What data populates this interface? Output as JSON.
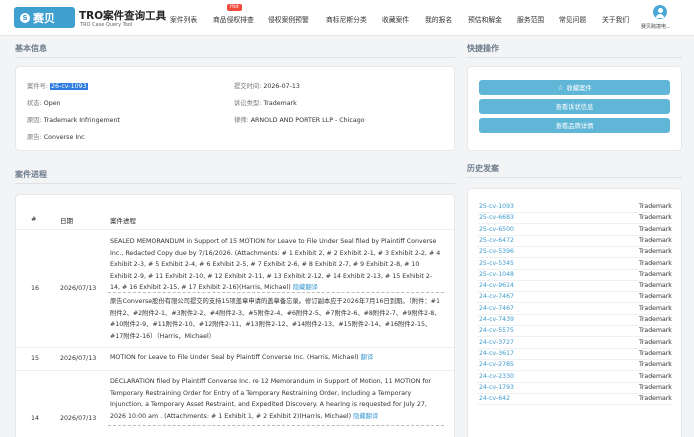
{
  "header": {
    "logo_text": "赛贝",
    "title": "TRO案件查询工具",
    "subtitle": "TRO Case Query Tool",
    "hot_badge": "Hot",
    "nav": [
      "案件列表",
      "商品侵权排查",
      "侵权案例预警",
      "商标尼斯分类",
      "收藏案件",
      "我的报名",
      "预估和解金",
      "服务范围",
      "常见问题",
      "关于我们"
    ],
    "user_name": "赛贝跨境电..."
  },
  "basic_info": {
    "title": "基本信息",
    "case_no_label": "案件号:",
    "case_no": "26-cv-1093",
    "filed_label": "提交时间:",
    "filed": "2026-07-13",
    "status_label": "状态:",
    "status": "Open",
    "ip_label": "诉讼类型:",
    "ip": "Trademark",
    "cause_label": "原因:",
    "cause": "Trademark Infringement",
    "law_label": "律师:",
    "law": "ARNOLD AND PORTER LLP - Chicago",
    "plaintiff_label": "原告:",
    "plaintiff": "Converse Inc"
  },
  "quick_actions": {
    "title": "快捷操作",
    "favorite": "收藏案件",
    "complaint": "查看诉状信息",
    "brand": "查看品牌详情"
  },
  "progress": {
    "title": "案件进程",
    "headers": [
      "#",
      "日期",
      "案件进程"
    ],
    "rows": [
      {
        "num": "16",
        "date": "2026/07/13",
        "en": "SEALED MEMORANDUM in Support of 15 MOTION for Leave to File Under Seal filed by Plaintiff Converse Inc., Redacted Copy due by 7/16/2026. (Attachments: # 1 Exhibit 2, # 2 Exhibit 2-1, # 3 Exhibit 2-2, # 4 Exhibit 2-3, # 5 Exhibit 2-4, # 6 Exhibit 2-5, # 7 Exhibit 2-6, # 8 Exhibit 2-7, # 9 Exhibit 2-8, # 10 Exhibit 2-9, # 11 Exhibit 2-10, # 12 Exhibit 2-11, # 13 Exhibit 2-12, # 14 Exhibit 2-13, # 15 Exhibit 2-14, # 16 Exhibit 2-15, # 17 Exhibit 2-16)(Harris, Michael)",
        "link": "隐藏翻译",
        "zh": "原告Converse股份有限公司提交的支持15项盖章申请的盖章备忘录。修订副本应于2026年7月16日到期。（附件：#1附件2、#2附件2-1、#3附件2-2、#4附件2-3、#5附件2-4、#6附件2-5、#7附件2-6、#8附件2-7、#9附件2-8、#10附件2-9、#11附件2-10、#12附件2-11、#13附件2-12、#14附件2-13、#15附件2-14、#16附件2-15、#17附件2-16）（Harris，Michael）"
      },
      {
        "num": "15",
        "date": "2026/07/13",
        "en": "MOTION for Leave to File Under Seal by Plaintiff Converse Inc. (Harris, Michael)",
        "link": "翻译"
      },
      {
        "num": "14",
        "date": "2026/07/13",
        "en": "DECLARATION filed by Plaintiff Converse Inc. re 12 Memorandum in Support of Motion, 11 MOTION for Temporary Restraining Order for Entry of a Temporary Restraining Order, Including a Temporary Injunction, a Temporary Asset Restraint, and Expedited Discovery. A hearing is requested for July 27, 2026 10:00 am . (Attachments: # 1 Exhibit 1, # 2 Exhibit 2)(Harris, Michael)",
        "link": "隐藏翻译"
      }
    ]
  },
  "history": {
    "title": "历史发案",
    "items": [
      {
        "case": "25-cv-1093",
        "type": "Trademark"
      },
      {
        "case": "25-cv-6683",
        "type": "Trademark"
      },
      {
        "case": "25-cv-6500",
        "type": "Trademark"
      },
      {
        "case": "25-cv-6472",
        "type": "Trademark"
      },
      {
        "case": "25-cv-5396",
        "type": "Trademark"
      },
      {
        "case": "25-cv-5345",
        "type": "Trademark"
      },
      {
        "case": "25-cv-1048",
        "type": "Trademark"
      },
      {
        "case": "24-cv-9614",
        "type": "Trademark"
      },
      {
        "case": "24-cv-7467",
        "type": "Trademark"
      },
      {
        "case": "24-cv-7467",
        "type": "Trademark"
      },
      {
        "case": "24-cv-7439",
        "type": "Trademark"
      },
      {
        "case": "24-cv-5575",
        "type": "Trademark"
      },
      {
        "case": "24-cv-3727",
        "type": "Trademark"
      },
      {
        "case": "24-cv-3617",
        "type": "Trademark"
      },
      {
        "case": "24-cv-2785",
        "type": "Trademark"
      },
      {
        "case": "24-cv-2330",
        "type": "Trademark"
      },
      {
        "case": "24-cv-1793",
        "type": "Trademark"
      },
      {
        "case": "24-cv-642",
        "type": "Trademark"
      }
    ]
  }
}
